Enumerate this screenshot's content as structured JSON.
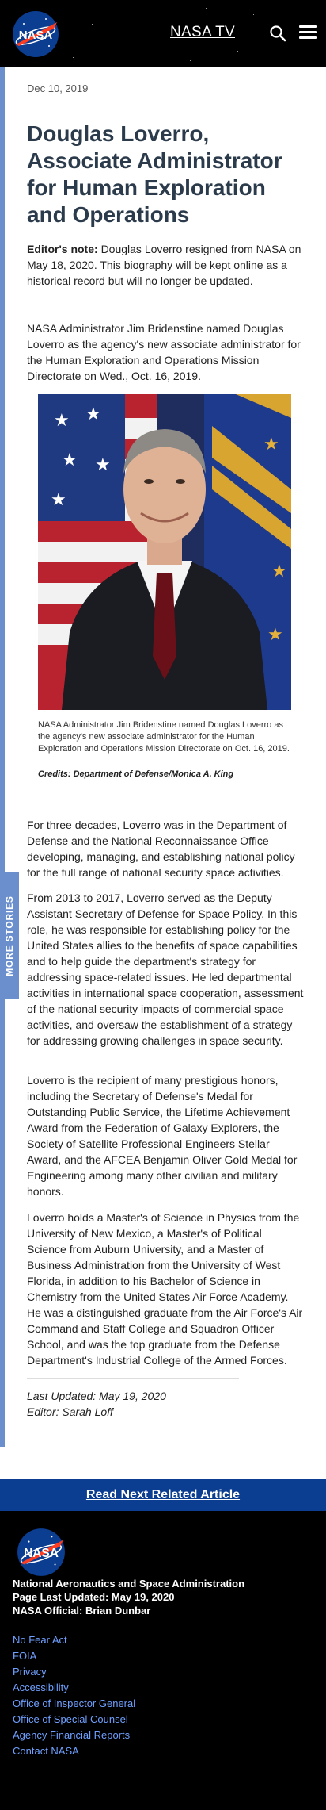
{
  "header": {
    "logo_text": "NASA",
    "nasa_tv": "NASA TV",
    "search_icon": "search-icon",
    "menu_icon": "hamburger-menu-icon"
  },
  "side_tab": {
    "label": "MORE STORIES"
  },
  "article": {
    "date": "Dec 10, 2019",
    "title": "Douglas Loverro, Associate Administrator for Human Exploration and Operations",
    "editor_note_label": "Editor's note:",
    "editor_note_text": "Douglas Loverro resigned from NASA on May 18, 2020. This biography will be kept online as a historical record but will no longer be updated.",
    "intro": "NASA Administrator Jim Bridenstine named Douglas Loverro as the agency's new associate administrator for the Human Exploration and Operations Mission Directorate on Wed., Oct. 16, 2019.",
    "image_caption": "NASA Administrator Jim Bridenstine named Douglas Loverro as the agency's new associate administrator for the Human Exploration and Operations Mission Directorate on Oct. 16, 2019.",
    "image_credits": "Credits: Department of Defense/Monica A. King",
    "paragraphs": [
      "For three decades, Loverro was in the Department of Defense and the National Reconnaissance Office developing, managing, and establishing national policy for the full range of national security space activities.",
      "From 2013 to 2017, Loverro served as the Deputy Assistant Secretary of Defense for Space Policy. In this role, he was responsible for establishing policy for the United States allies to the benefits of space capabilities and to help guide the department's strategy for addressing space-related issues. He led departmental activities in international space cooperation, assessment of the national security impacts of commercial space activities, and oversaw the establishment of a strategy for addressing growing challenges in space security.",
      "Loverro is the recipient of many prestigious honors, including the Secretary of Defense's Medal for Outstanding Public Service, the Lifetime Achievement Award from the Federation of Galaxy Explorers, the Society of Satellite Professional Engineers Stellar Award, and the AFCEA Benjamin Oliver Gold Medal for Engineering among many other civilian and military honors.",
      "Loverro holds a Master's of Science in Physics from the University of New Mexico, a Master's of Political Science from Auburn University, and a Master of Business Administration from the University of West Florida, in addition to his Bachelor of Science in Chemistry from the United States Air Force Academy. He was a distinguished graduate from the Air Force's Air Command and Staff College and Squadron Officer School, and was the top graduate from the Defense Department's Industrial College of the Armed Forces."
    ],
    "last_updated": "Last Updated: May 19, 2020",
    "editor": "Editor: Sarah Loff"
  },
  "read_next": "Read Next Related Article",
  "footer": {
    "logo_text": "NASA",
    "org_name": "National Aeronautics and Space Administration",
    "page_last_updated": "Page Last Updated: May 19, 2020",
    "official": "NASA Official: Brian Dunbar",
    "links": [
      "No Fear Act",
      "FOIA",
      "Privacy",
      "Accessibility",
      "Office of Inspector General",
      "Office of Special Counsel",
      "Agency Financial Reports",
      "Contact NASA"
    ]
  },
  "colors": {
    "header_bg": "#000000",
    "title": "#2b3b4b",
    "side_tab": "#6b8fcc",
    "read_next_bg": "#0b3d91",
    "footer_link": "#6fa0ff",
    "nasa_blue": "#0b3d91",
    "nasa_red": "#fc3d21"
  }
}
